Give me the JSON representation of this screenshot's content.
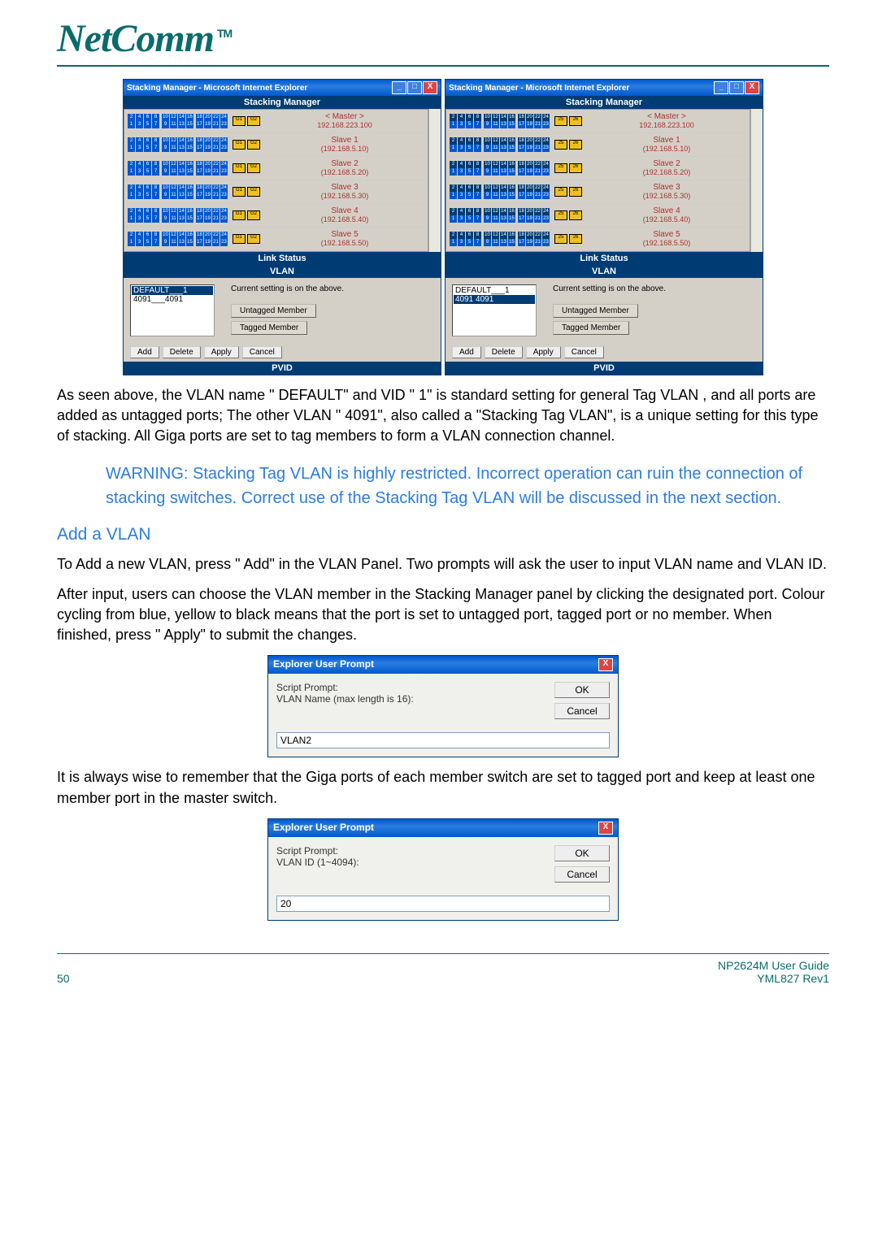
{
  "logo": {
    "text": "NetComm",
    "tm": "TM"
  },
  "stacking_window": {
    "title": "Stacking Manager - Microsoft Internet Explorer",
    "section_stacking": "Stacking Manager",
    "section_link": "Link Status",
    "section_vlan": "VLAN",
    "section_pvid": "PVID",
    "switches": [
      {
        "label": "< Master >",
        "ip": "192.168.223.100"
      },
      {
        "label": "Slave 1",
        "ip": "(192.168.5.10)"
      },
      {
        "label": "Slave 2",
        "ip": "(192.168.5.20)"
      },
      {
        "label": "Slave 3",
        "ip": "(192.168.5.30)"
      },
      {
        "label": "Slave 4",
        "ip": "(192.168.5.40)"
      },
      {
        "label": "Slave 5",
        "ip": "(192.168.5.50)"
      }
    ],
    "vlan_items": [
      "DEFAULT___1",
      "4091___4091"
    ],
    "vlan_items_b": [
      "DEFAULT___1",
      "4091   4091"
    ],
    "vlan_note": "Current setting is on the above.",
    "legend_untagged": "Untagged Member",
    "legend_tagged": "Tagged Member",
    "btn_add": "Add",
    "btn_delete": "Delete",
    "btn_apply": "Apply",
    "btn_cancel": "Cancel",
    "giga": [
      "G1",
      "G2"
    ],
    "port_top": [
      "2",
      "4",
      "6",
      "8",
      "10",
      "12",
      "14",
      "16",
      "18",
      "20",
      "22",
      "24"
    ],
    "port_bot": [
      "1",
      "3",
      "5",
      "7",
      "9",
      "11",
      "13",
      "15",
      "17",
      "19",
      "21",
      "23"
    ],
    "giga_alt": [
      "25",
      "26"
    ]
  },
  "para1": "As seen above, the VLAN name \" DEFAULT\" and VID \" 1\" is standard setting for general Tag VLAN , and all ports are added as untagged ports; The other VLAN \" 4091\", also called a \"Stacking Tag VLAN\", is a unique setting for this type of stacking.  All  Giga ports are set to tag members to form a VLAN connection channel.",
  "warning": "WARNING: Stacking Tag VLAN is highly restricted.  Incorrect operation can ruin the connection of stacking switches.  Correct use of the Stacking Tag VLAN will be discussed in the next section.",
  "heading_add": "Add a VLAN",
  "para2": "To Add a new VLAN, press \" Add\" in the VLAN Panel.  Two prompts will ask the user to input VLAN name and VLAN ID.",
  "para3": "After input, users can choose the VLAN member in the Stacking Manager panel by clicking the designated port.  Colour cycling from blue, yellow to black means that the port is set to untagged port, tagged port or no member.  When finished, press \" Apply\" to submit the changes.",
  "prompt1": {
    "title": "Explorer User Prompt",
    "label1": "Script Prompt:",
    "label2": "VLAN Name (max length is 16):",
    "value": "VLAN2",
    "ok": "OK",
    "cancel": "Cancel"
  },
  "para4": "It is always wise to remember that the Giga ports of each member switch are set to tagged port and keep at least one member port in the master switch.",
  "prompt2": {
    "title": "Explorer User Prompt",
    "label1": "Script Prompt:",
    "label2": "VLAN ID (1~4094):",
    "value": "20",
    "ok": "OK",
    "cancel": "Cancel"
  },
  "footer": {
    "page": "50",
    "guide": "NP2624M User Guide",
    "rev": "YML827 Rev1"
  }
}
